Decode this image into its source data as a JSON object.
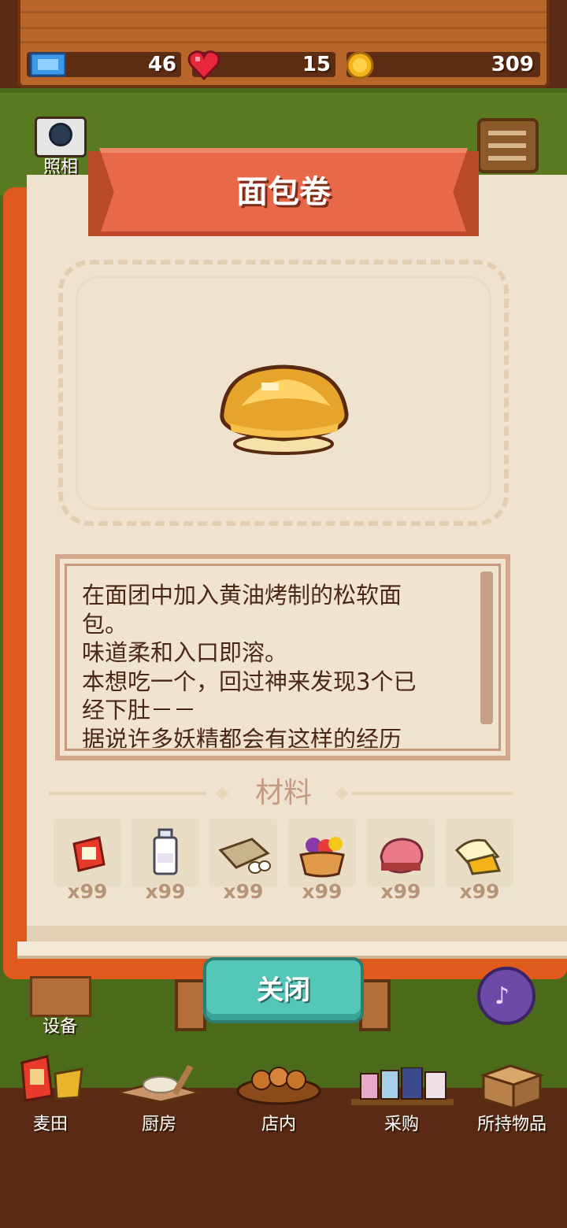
{
  "status_bar": {
    "tickets": "46",
    "hearts": "15",
    "coins": "309"
  },
  "side": {
    "camera_label": "照相",
    "equipment_label": "设备"
  },
  "recipe": {
    "title": "面包卷",
    "description_lines": [
      "在面团中加入黄油烤制的松软面",
      "包。",
      "味道柔和入口即溶。",
      "本想吃一个，回过神来发现3个已",
      "经下肚－－",
      "据说许多妖精都会有这样的经历"
    ]
  },
  "materials": {
    "title": "材料",
    "items": [
      {
        "icon": "flour-bag-icon",
        "count": "x99"
      },
      {
        "icon": "milk-bottle-icon",
        "count": "x99"
      },
      {
        "icon": "butter-eggs-icon",
        "count": "x99"
      },
      {
        "icon": "fruit-basket-icon",
        "count": "x99"
      },
      {
        "icon": "meat-icon",
        "count": "x99"
      },
      {
        "icon": "cheese-icon",
        "count": "x99"
      }
    ]
  },
  "close_button": "关闭",
  "bottom_nav": [
    {
      "label": "麦田",
      "icon": "wheat-field-icon"
    },
    {
      "label": "厨房",
      "icon": "kitchen-icon"
    },
    {
      "label": "店内",
      "icon": "bread-basket-icon"
    },
    {
      "label": "采购",
      "icon": "shop-icon"
    },
    {
      "label": "所持物品",
      "icon": "box-icon"
    }
  ],
  "colors": {
    "ribbon": "#e8684a",
    "close_button": "#55c7b8",
    "book_cover": "#e05a1e",
    "page": "#efe3cf"
  }
}
